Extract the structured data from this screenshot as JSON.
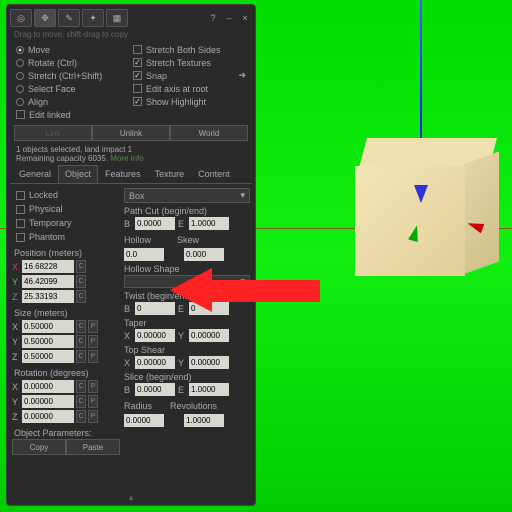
{
  "panel": {
    "hint": "Drag to move, shift-drag to copy"
  },
  "modes": {
    "move": "Move",
    "rotate": "Rotate (Ctrl)",
    "stretch": "Stretch (Ctrl+Shift)",
    "selectface": "Select Face",
    "align": "Align",
    "editlinked": "Edit linked"
  },
  "options": {
    "stretchboth": "Stretch Both Sides",
    "stretchtex": "Stretch Textures",
    "snap": "Snap",
    "editroot": "Edit axis at root",
    "highlight": "Show Highlight"
  },
  "buttons": {
    "link": "Link",
    "unlink": "Unlink",
    "world": "World",
    "copy": "Copy",
    "paste": "Paste"
  },
  "status": {
    "line1": "1 objects selected, land impact 1",
    "line2": "Remaining capacity 6035.",
    "moreinfo": "More info"
  },
  "tabs": [
    "General",
    "Object",
    "Features",
    "Texture",
    "Content"
  ],
  "flags": {
    "locked": "Locked",
    "physical": "Physical",
    "temporary": "Temporary",
    "phantom": "Phantom"
  },
  "labels": {
    "position": "Position (meters)",
    "size": "Size (meters)",
    "rotation": "Rotation (degrees)",
    "objparams": "Object Parameters:",
    "pathcut": "Path Cut (begin/end)",
    "hollow": "Hollow",
    "skew": "Skew",
    "hollowshape": "Hollow Shape",
    "twist": "Twist (begin/end)",
    "taper": "Taper",
    "topshear": "Top Shear",
    "slice": "Slice (begin/end)",
    "radius": "Radius",
    "revolutions": "Revolutions"
  },
  "position": {
    "x": "16.68228",
    "y": "46.42099",
    "z": "25.33193"
  },
  "size": {
    "x": "0.50000",
    "y": "0.50000",
    "z": "0.50000"
  },
  "rotation": {
    "x": "0.00000",
    "y": "0.00000",
    "z": "0.00000"
  },
  "shape": {
    "type": "Box",
    "pathcut_b": "0.0000",
    "pathcut_e": "1.0000",
    "hollow": "0.0",
    "skew": "0.000",
    "twist_b": "0",
    "twist_e": "0",
    "taper_x": "0.00000",
    "taper_y": "0.00000",
    "shear_x": "0.00000",
    "shear_y": "0.00000",
    "slice_b": "0.0000",
    "slice_e": "1.0000",
    "radius": "0.0000",
    "revolutions": "1.0000"
  }
}
